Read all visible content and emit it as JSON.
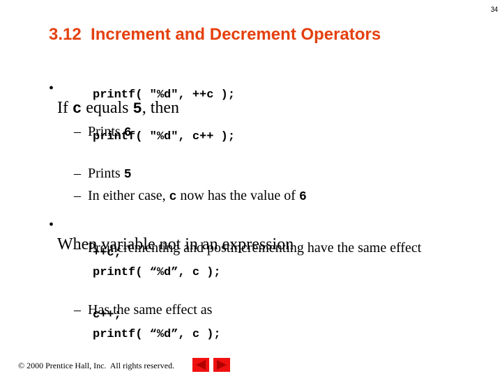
{
  "page_number": "34",
  "title": "3.12  Increment and Decrement Operators",
  "bullets": [
    {
      "bullet_glyph": "•",
      "text_parts": [
        "If ",
        "c",
        " equals ",
        "5",
        ", then"
      ],
      "code": "printf( \"%d\", ++c );"
    },
    {
      "bullet_glyph": "•",
      "text": "When variable not in an expression"
    }
  ],
  "sub_items": {
    "prints6": [
      "Prints ",
      "6"
    ],
    "code2": "printf( \"%d\", c++ );",
    "prints5": [
      "Prints ",
      "5"
    ],
    "either": [
      "In either case, ",
      "c",
      " now has the value of ",
      "6"
    ],
    "pre_post": "Preincrementing and postincrementing have the same effect",
    "code3a": "++c;",
    "code3b": "printf( “%d”, c );",
    "same_as": "Has the same effect as",
    "code4a": "c++;",
    "code4b": "printf( “%d”, c );"
  },
  "dash_glyph": "–",
  "footer": {
    "copyright": "© 2000 Prentice Hall, Inc.  All rights reserved.",
    "prev_icon": "previous-slide-arrow",
    "next_icon": "next-slide-arrow",
    "nav_color": "#f01010",
    "arrow_color": "#b00000"
  }
}
